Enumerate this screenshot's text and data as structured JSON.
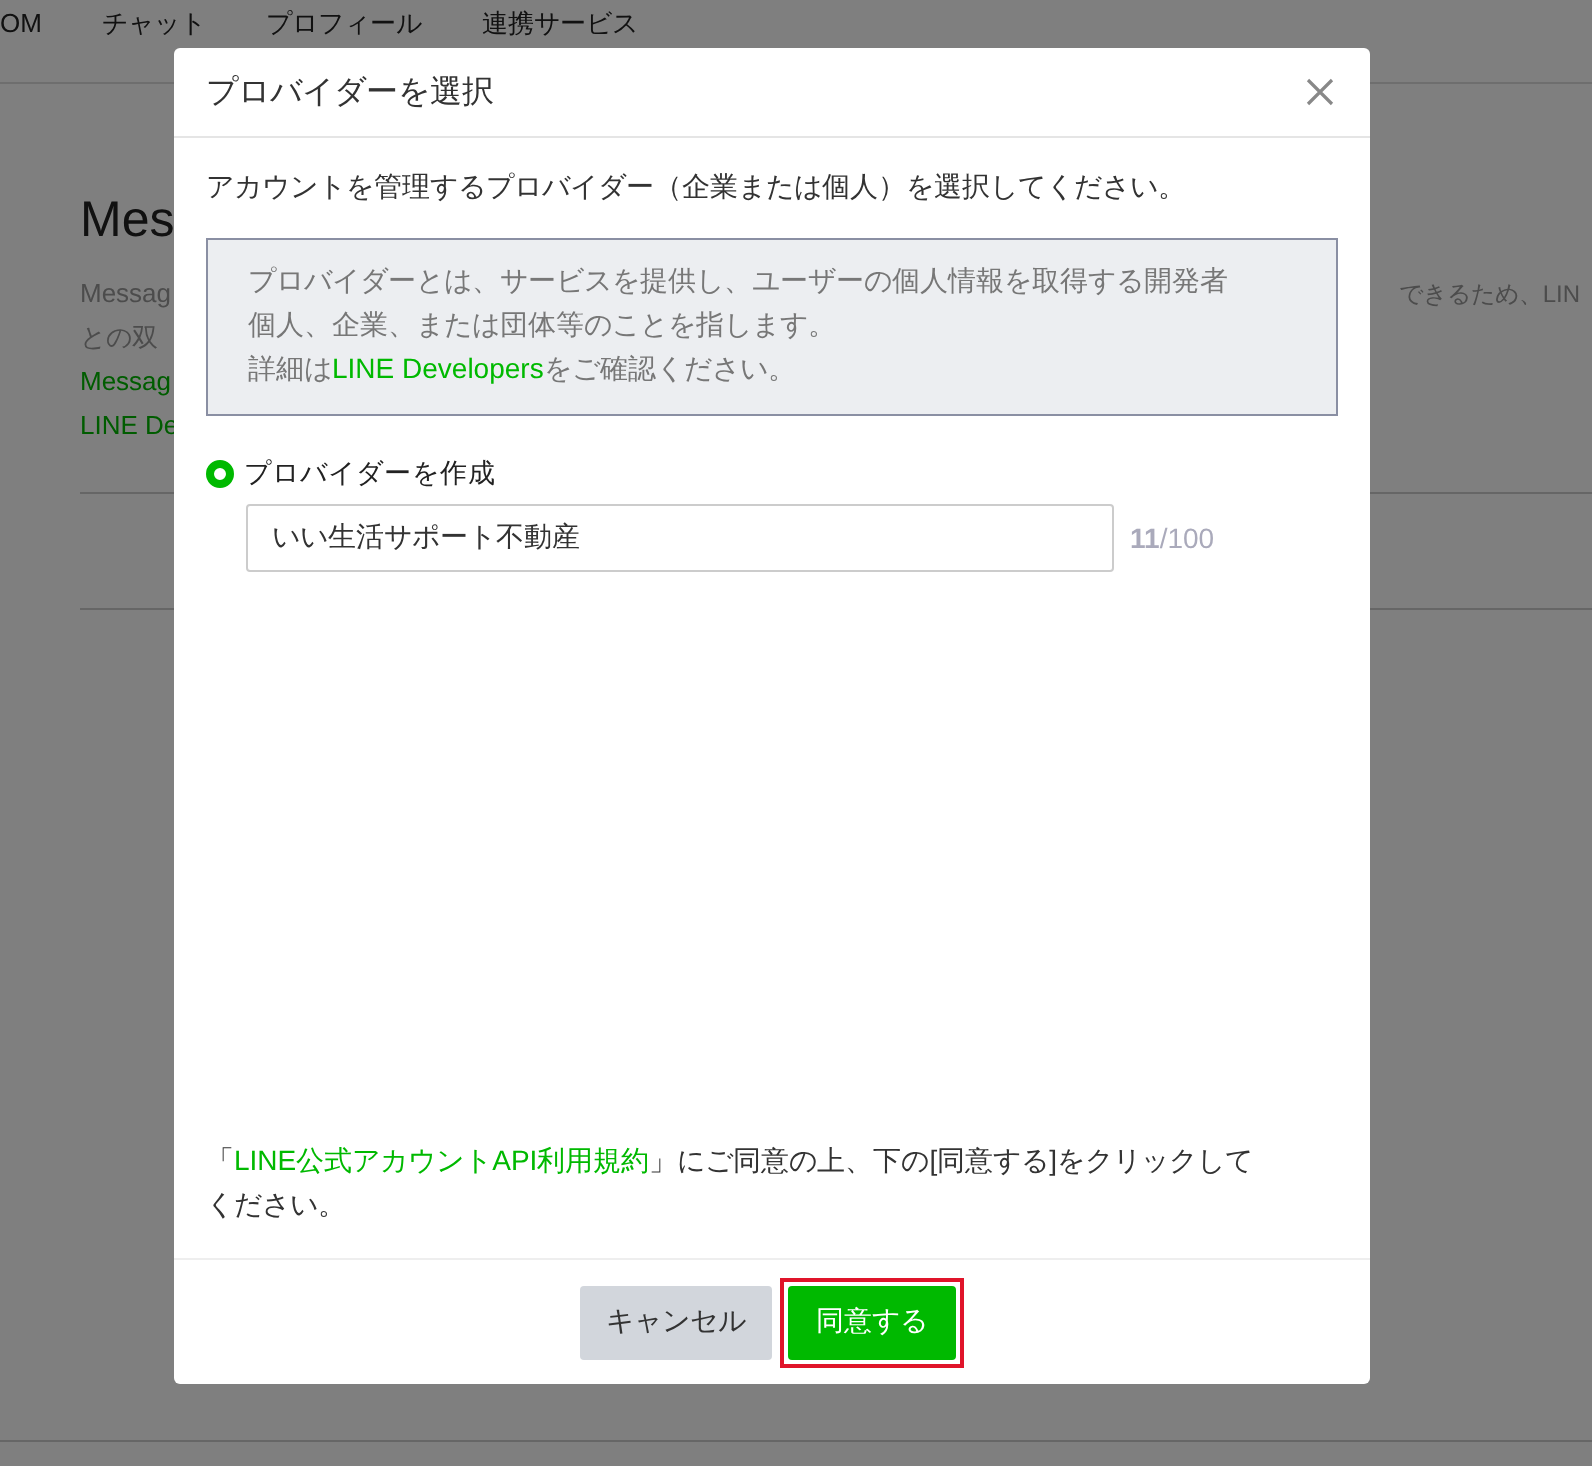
{
  "background_page": {
    "nav_tabs": [
      "OM",
      "チャット",
      "プロフィール",
      "連携サービス"
    ],
    "heading": "Mes",
    "left_lines": [
      {
        "text": "Messag",
        "kind": "plain"
      },
      {
        "text": "との双",
        "kind": "plain"
      },
      {
        "text": "Messag",
        "kind": "link"
      },
      {
        "text": "LINE De",
        "kind": "link"
      }
    ],
    "right_line": "できるため、LIN"
  },
  "dialog": {
    "title": "プロバイダーを選択",
    "intro": "アカウントを管理するプロバイダー（企業または個人）を選択してください。",
    "info_box": {
      "text": "プロバイダーとは、サービスを提供し、ユーザーの個人情報を取得する開発者個人、企業、または団体等のことを指します。",
      "detail_prefix": "詳細は",
      "detail_link": "LINE Developers",
      "detail_suffix": "をご確認ください。"
    },
    "options": [
      {
        "label": "プロバイダーを作成",
        "selected": true
      }
    ],
    "name_field": {
      "value": "いい生活サポート不動産",
      "counter": "**11**/100"
    },
    "agreement": {
      "open_bracket": "「",
      "link": "LINE公式アカウントAPI利用規約",
      "rest": "」にご同意の上、下の[同意する]をクリックしてください。"
    },
    "buttons": [
      {
        "label": "キャンセル",
        "kind": "secondary",
        "highlighted": false
      },
      {
        "label": "同意する",
        "kind": "primary",
        "highlighted": true
      }
    ]
  }
}
